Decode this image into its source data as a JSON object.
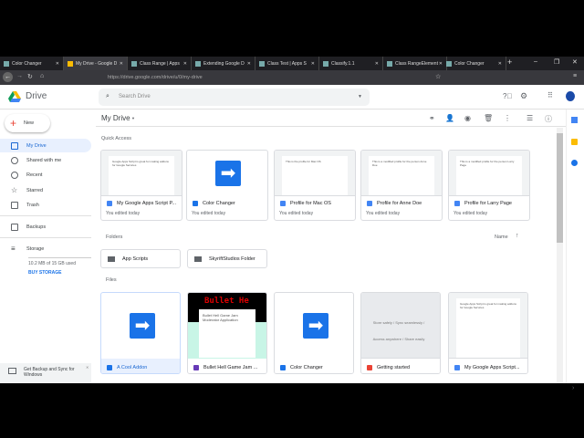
{
  "browser": {
    "tabs": [
      "Color Changer",
      "My Drive - Google D",
      "Class Range | Apps",
      "Extending Google D",
      "Class Test | Apps S",
      "Classify.1.1",
      "Class RangeElement",
      "Color Changer"
    ],
    "url": "https://drive.google.com/drive/u/0/my-drive"
  },
  "header": {
    "app_name": "Drive",
    "search_placeholder": "Search Drive"
  },
  "sidebar": {
    "new_label": "New",
    "items": [
      "My Drive",
      "Shared with me",
      "Recent",
      "Starred",
      "Trash",
      "Backups",
      "Storage"
    ],
    "storage_used": "10.2 MB of 15 GB used",
    "buy_storage": "BUY STORAGE",
    "banner": "Get Backup and Sync for Windows"
  },
  "main": {
    "title": "My Drive",
    "quick_access_label": "Quick Access",
    "quick_access": [
      {
        "name": "My Google Apps Script P...",
        "sub": "You edited today",
        "type": "doc",
        "preview": "Google Apps Script is great for making addons for Google Services"
      },
      {
        "name": "Color Changer",
        "sub": "You edited today",
        "type": "script"
      },
      {
        "name": "Profile for Mac OS",
        "sub": "You edited today",
        "type": "doc",
        "preview": "This is the profile for Mac OS"
      },
      {
        "name": "Profile for Anne Doe",
        "sub": "You edited today",
        "type": "doc",
        "preview": "This is a modified profile for the person Anne Doe"
      },
      {
        "name": "Profile for Larry Page",
        "sub": "You edited today",
        "type": "doc",
        "preview": "This is a modified profile for the person Larry Page"
      }
    ],
    "folders_label": "Folders",
    "sort_label": "Name",
    "folders": [
      "App Scripts",
      "SkyriftStudios Folder"
    ],
    "files_label": "Files",
    "files": [
      {
        "name": "A Cool Addon",
        "type": "script"
      },
      {
        "name": "Bullet Hell Game Jam ...",
        "type": "form",
        "preview": "Bullet Hell Game Jam Moderator Application"
      },
      {
        "name": "Color Changer",
        "type": "script"
      },
      {
        "name": "Getting started",
        "type": "pdf",
        "preview": "Store safely / Sync seamlessly / Access anywhere / Share easily"
      },
      {
        "name": "My Google Apps Script...",
        "type": "doc",
        "preview": "Google Apps Script is great for making addons for Google Services"
      }
    ]
  },
  "colors": {
    "doc": "#4285f4",
    "script": "#1a73e8",
    "form": "#673ab7",
    "pdf": "#ea4335"
  }
}
